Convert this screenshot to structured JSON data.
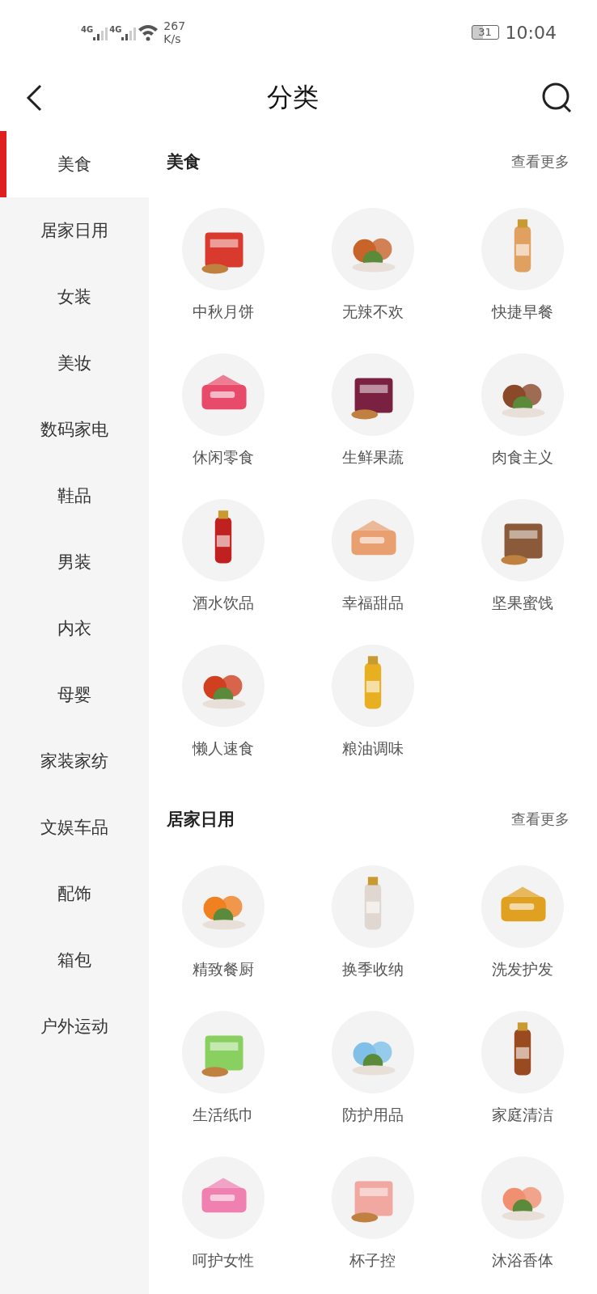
{
  "status_bar": {
    "network_1": "4G",
    "network_2": "4G",
    "speed": "267",
    "speed_unit": "K/s",
    "battery": "31",
    "time": "10:04"
  },
  "header": {
    "title": "分类"
  },
  "sidebar": {
    "items": [
      {
        "label": "美食",
        "selected": true
      },
      {
        "label": "居家日用",
        "selected": false
      },
      {
        "label": "女装",
        "selected": false
      },
      {
        "label": "美妆",
        "selected": false
      },
      {
        "label": "数码家电",
        "selected": false
      },
      {
        "label": "鞋品",
        "selected": false
      },
      {
        "label": "男装",
        "selected": false
      },
      {
        "label": "内衣",
        "selected": false
      },
      {
        "label": "母婴",
        "selected": false
      },
      {
        "label": "家装家纺",
        "selected": false
      },
      {
        "label": "文娱车品",
        "selected": false
      },
      {
        "label": "配饰",
        "selected": false
      },
      {
        "label": "箱包",
        "selected": false
      },
      {
        "label": "户外运动",
        "selected": false
      }
    ]
  },
  "sections": [
    {
      "title": "美食",
      "more": "查看更多",
      "items": [
        {
          "label": "中秋月饼"
        },
        {
          "label": "无辣不欢"
        },
        {
          "label": "快捷早餐"
        },
        {
          "label": "休闲零食"
        },
        {
          "label": "生鲜果蔬"
        },
        {
          "label": "肉食主义"
        },
        {
          "label": "酒水饮品"
        },
        {
          "label": "幸福甜品"
        },
        {
          "label": "坚果蜜饯"
        },
        {
          "label": "懒人速食"
        },
        {
          "label": "粮油调味"
        }
      ]
    },
    {
      "title": "居家日用",
      "more": "查看更多",
      "items": [
        {
          "label": "精致餐厨"
        },
        {
          "label": "换季收纳"
        },
        {
          "label": "洗发护发"
        },
        {
          "label": "生活纸巾"
        },
        {
          "label": "防护用品"
        },
        {
          "label": "家庭清洁"
        },
        {
          "label": "呵护女性"
        },
        {
          "label": "杯子控"
        },
        {
          "label": "沐浴香体"
        }
      ]
    }
  ]
}
